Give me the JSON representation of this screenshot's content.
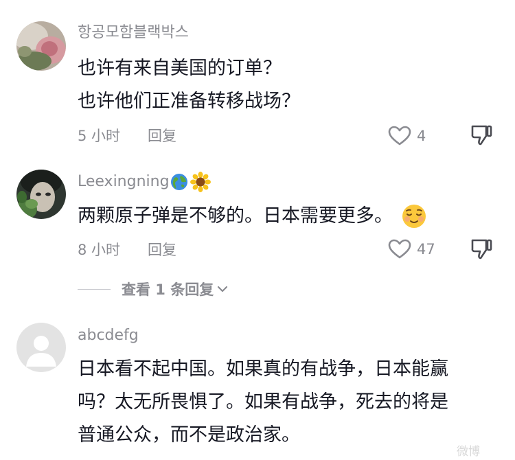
{
  "comments": [
    {
      "username": "항공모함블랙박스",
      "lines": [
        "也许有来自美国的订单？",
        "也许他们正准备转移战场？"
      ],
      "time": "5 小时",
      "reply": "回复",
      "likes": "4"
    },
    {
      "username": "Leexingning",
      "username_emojis": [
        "globe-emoji",
        "sunflower-emoji"
      ],
      "lines": [
        "两颗原子弹是不够的。日本需要更多。"
      ],
      "trailing_emoji": "relieved-face-emoji",
      "time": "8 小时",
      "reply": "回复",
      "likes": "47",
      "view_replies": "查看 1 条回复"
    },
    {
      "username": "abcdefg",
      "lines": [
        "日本看不起中国。如果真的有战争，日本能赢",
        "吗？太无所畏惧了。如果有战争，死去的将是",
        "普通公众，而不是政治家。"
      ]
    }
  ],
  "watermark": "微博",
  "colors": {
    "primary_text": "#161823",
    "secondary_text": "#8a8b91",
    "background": "#ffffff"
  }
}
